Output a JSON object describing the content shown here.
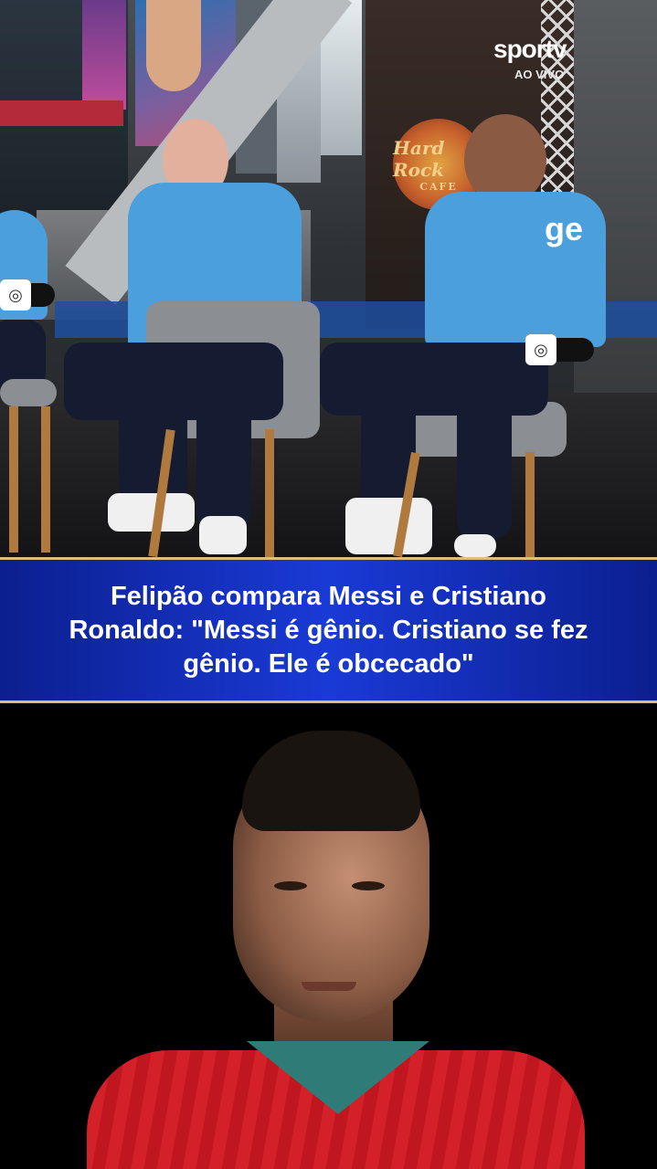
{
  "broadcast": {
    "channel_logo": "sportv",
    "channel_status": "AO VIVO",
    "watermark": "ge"
  },
  "scene": {
    "sign_top": "Hard Rock",
    "sign_bottom": "CAFE"
  },
  "caption": {
    "text": "Felipão compara Messi e Cristiano Ronaldo: \"Messi é gênio. Cristiano se fez gênio. Ele é obcecado\""
  },
  "colors": {
    "caption_band": "#1a3ad6",
    "caption_border": "#d8c07a",
    "shirts": "#4b9fdc",
    "jersey": "#c0161f"
  }
}
